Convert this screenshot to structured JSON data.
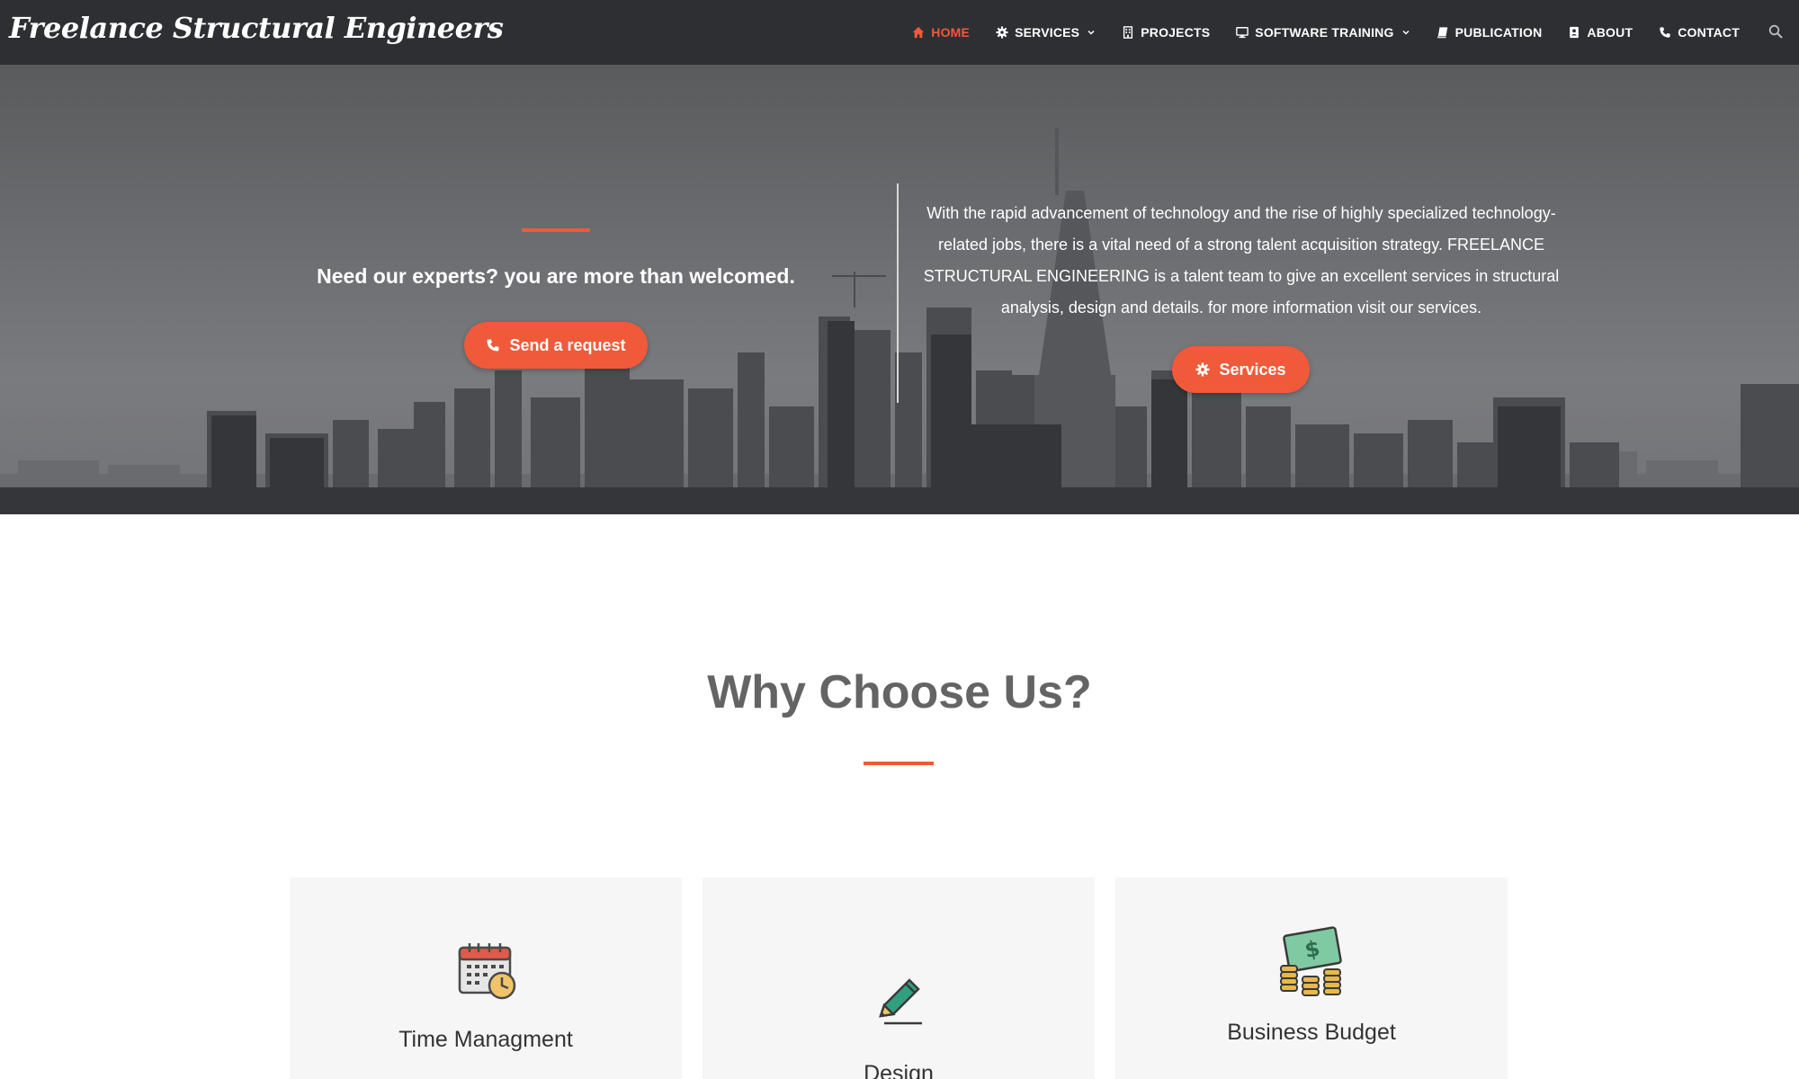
{
  "site": {
    "logo": "Freelance Structural Engineers"
  },
  "nav": {
    "items": [
      {
        "label": "HOME",
        "icon": "home-icon",
        "active": true
      },
      {
        "label": "SERVICES",
        "icon": "gear-icon",
        "dropdown": true
      },
      {
        "label": "PROJECTS",
        "icon": "building-icon"
      },
      {
        "label": "SOFTWARE TRAINING",
        "icon": "monitor-icon",
        "dropdown": true
      },
      {
        "label": "PUBLICATION",
        "icon": "book-icon"
      },
      {
        "label": "ABOUT",
        "icon": "contact-card-icon"
      },
      {
        "label": "CONTACT",
        "icon": "phone-icon"
      }
    ],
    "search_icon": "search-icon"
  },
  "hero": {
    "heading": "Need our experts? you are more than welcomed.",
    "request_button": "Send a request",
    "description": "With the rapid advancement of technology and the rise of highly specialized technology-related jobs, there is a vital need of a strong talent acquisition strategy. FREELANCE STRUCTURAL ENGINEERING is a talent team to give an excellent services in structural analysis, design and details. for more information visit our services.",
    "services_button": "Services"
  },
  "why": {
    "title": "Why Choose Us?",
    "cards": [
      {
        "title": "Time Managment",
        "icon": "calendar-clock-icon"
      },
      {
        "title": "Design",
        "icon": "pencil-icon"
      },
      {
        "title": "Business Budget",
        "icon": "money-coins-icon"
      }
    ]
  },
  "colors": {
    "accent": "#f05a3a",
    "navbar_bg": "#2d2f32",
    "card_bg": "#f6f6f6"
  }
}
